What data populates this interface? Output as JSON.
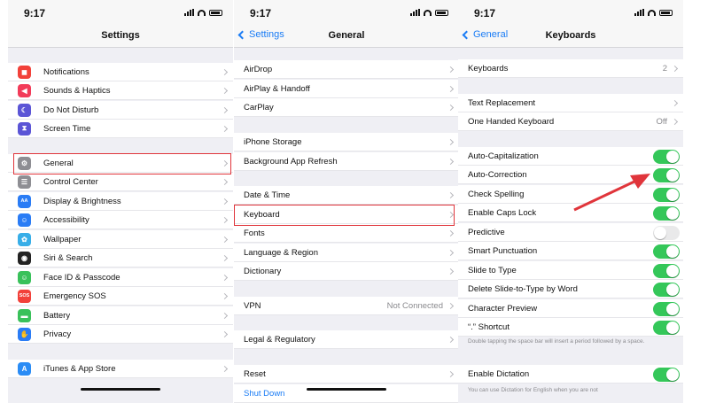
{
  "status": {
    "time": "9:17"
  },
  "settings": {
    "title": "Settings",
    "items": [
      {
        "label": "Notifications",
        "icon": "notifications-icon",
        "color": "#f2413a",
        "glyph": "◼"
      },
      {
        "label": "Sounds & Haptics",
        "icon": "sounds-icon",
        "color": "#f23b59",
        "glyph": "◀"
      },
      {
        "label": "Do Not Disturb",
        "icon": "moon-icon",
        "color": "#5b55d6",
        "glyph": "☾"
      },
      {
        "label": "Screen Time",
        "icon": "hourglass-icon",
        "color": "#5b55d6",
        "glyph": "⧗"
      },
      {
        "label": "General",
        "icon": "gear-icon",
        "color": "#8e8e93",
        "glyph": "⚙"
      },
      {
        "label": "Control Center",
        "icon": "control-center-icon",
        "color": "#8e8e93",
        "glyph": "☰"
      },
      {
        "label": "Display & Brightness",
        "icon": "display-icon",
        "color": "#2a7cf5",
        "glyph": "AA"
      },
      {
        "label": "Accessibility",
        "icon": "accessibility-icon",
        "color": "#2a7cf5",
        "glyph": "☺"
      },
      {
        "label": "Wallpaper",
        "icon": "wallpaper-icon",
        "color": "#38aee8",
        "glyph": "✿"
      },
      {
        "label": "Siri & Search",
        "icon": "siri-icon",
        "color": "#222222",
        "glyph": "◉"
      },
      {
        "label": "Face ID & Passcode",
        "icon": "face-id-icon",
        "color": "#39c15a",
        "glyph": "☺"
      },
      {
        "label": "Emergency SOS",
        "icon": "sos-icon",
        "color": "#f2413a",
        "glyph": "SOS"
      },
      {
        "label": "Battery",
        "icon": "battery-icon",
        "color": "#39c15a",
        "glyph": "▬"
      },
      {
        "label": "Privacy",
        "icon": "hand-icon",
        "color": "#2a7cf5",
        "glyph": "✋"
      },
      {
        "label": "iTunes & App Store",
        "icon": "app-store-icon",
        "color": "#2a8cf5",
        "glyph": "A"
      }
    ]
  },
  "general": {
    "back": "Settings",
    "title": "General",
    "items": [
      {
        "label": "AirDrop"
      },
      {
        "label": "AirPlay & Handoff"
      },
      {
        "label": "CarPlay"
      },
      {
        "label": "iPhone Storage"
      },
      {
        "label": "Background App Refresh"
      },
      {
        "label": "Date & Time"
      },
      {
        "label": "Keyboard"
      },
      {
        "label": "Fonts"
      },
      {
        "label": "Language & Region"
      },
      {
        "label": "Dictionary"
      },
      {
        "label": "VPN",
        "value": "Not Connected"
      },
      {
        "label": "Legal & Regulatory"
      },
      {
        "label": "Reset"
      },
      {
        "label": "Shut Down"
      }
    ]
  },
  "keyboards": {
    "back": "General",
    "title": "Keyboards",
    "items": [
      {
        "label": "Keyboards",
        "value": "2"
      },
      {
        "label": "Text Replacement"
      },
      {
        "label": "One Handed Keyboard",
        "value": "Off"
      },
      {
        "label": "Auto-Capitalization",
        "on": true
      },
      {
        "label": "Auto-Correction",
        "on": true
      },
      {
        "label": "Check Spelling",
        "on": true
      },
      {
        "label": "Enable Caps Lock",
        "on": true
      },
      {
        "label": "Predictive",
        "on": false
      },
      {
        "label": "Smart Punctuation",
        "on": true
      },
      {
        "label": "Slide to Type",
        "on": true
      },
      {
        "label": "Delete Slide-to-Type by Word",
        "on": true
      },
      {
        "label": "Character Preview",
        "on": true
      },
      {
        "label": "“.” Shortcut",
        "on": true
      },
      {
        "label": "Enable Dictation",
        "on": true
      }
    ],
    "shortcut_note": "Double tapping the space bar will insert a period followed by a space.",
    "dictation_note": "You can use Dictation for English when you are not"
  },
  "colors": {
    "accent": "#1a7cf5",
    "toggle_on": "#34c759",
    "highlight": "#e0353b"
  }
}
